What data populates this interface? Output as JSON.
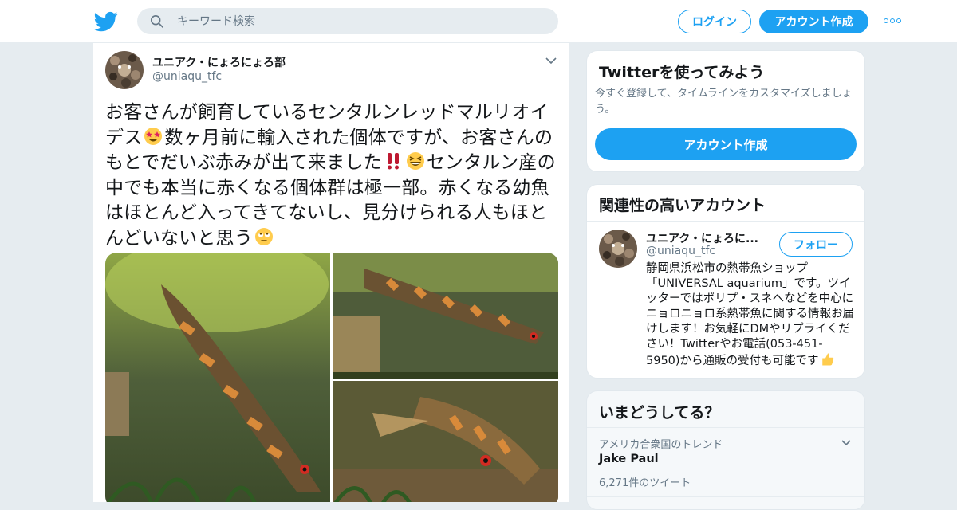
{
  "header": {
    "logo_icon": "twitter-bird-icon",
    "search_placeholder": "キーワード検索",
    "login_label": "ログイン",
    "signup_label": "アカウント作成",
    "more_icon": "more-dots-icon"
  },
  "tweet": {
    "author_name": "ユニアク・にょろにょろ部",
    "author_handle": "@uniaqu_tfc",
    "text_parts": [
      "お客さんが飼育しているセンタルンレッドマルリオイデス",
      "数ヶ月前に輸入された個体ですが、お客さんのもとでだいぶ赤みが出て来ました",
      "センタルン産の中でも本当に赤くなる個体群は極一部。赤くなる幼魚はほとんど入ってきてないし、見分けられる人もほとんどいないと思う"
    ],
    "emojis": [
      "star-struck-emoji",
      "double-exclamation-emoji",
      "grinning-squinting-emoji",
      "face-with-rolling-eyes-emoji"
    ],
    "media_count": 3
  },
  "sidebar": {
    "signup_card": {
      "title": "Twitterを使ってみよう",
      "subtitle": "今すぐ登録して、タイムラインをカスタマイズしましょう。",
      "button_label": "アカウント作成"
    },
    "related_card": {
      "title": "関連性の高いアカウント",
      "account_name": "ユニアク・にょろに...",
      "account_handle": "@uniaqu_tfc",
      "follow_label": "フォロー",
      "bio": "静岡県浜松市の熱帯魚ショップ「UNIVERSAL aquarium」です。ツイッターではポリプ・スネへなどを中心にニョロニョロ系熱帯魚に関する情報お届けします！お気軽にDMやリプライください！Twitterやお電話(053-451-5950)から通販の受付も可能です"
    },
    "trends_card": {
      "title": "いまどうしてる？",
      "items": [
        {
          "context": "アメリカ合衆国のトレンド",
          "name": "Jake Paul",
          "count": "6,271件のツイート"
        }
      ]
    }
  },
  "colors": {
    "accent": "#1da1f2",
    "background": "#e6ecf0",
    "text": "#14171a",
    "muted": "#657786"
  }
}
